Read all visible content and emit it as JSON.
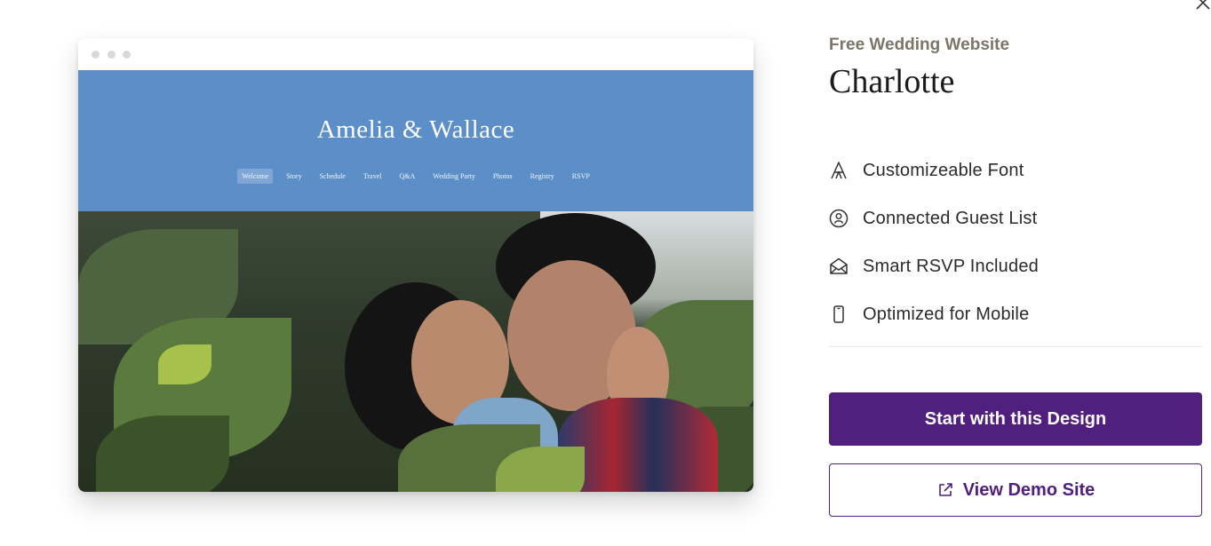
{
  "preview": {
    "site_title": "Amelia & Wallace",
    "nav": [
      "Welcome",
      "Story",
      "Schedule",
      "Travel",
      "Q&A",
      "Wedding Party",
      "Photos",
      "Registry",
      "RSVP"
    ],
    "active_nav": "Welcome",
    "header_color": "#5c8ec8"
  },
  "panel": {
    "eyebrow": "Free Wedding Website",
    "design_name": "Charlotte",
    "features": [
      {
        "icon": "font-icon",
        "label": "Customizeable Font"
      },
      {
        "icon": "guest-list-icon",
        "label": "Connected Guest List"
      },
      {
        "icon": "envelope-icon",
        "label": "Smart RSVP Included"
      },
      {
        "icon": "mobile-icon",
        "label": "Optimized for Mobile"
      }
    ],
    "primary_button": "Start with this Design",
    "secondary_button": "View Demo Site",
    "accent_color": "#51207e"
  }
}
